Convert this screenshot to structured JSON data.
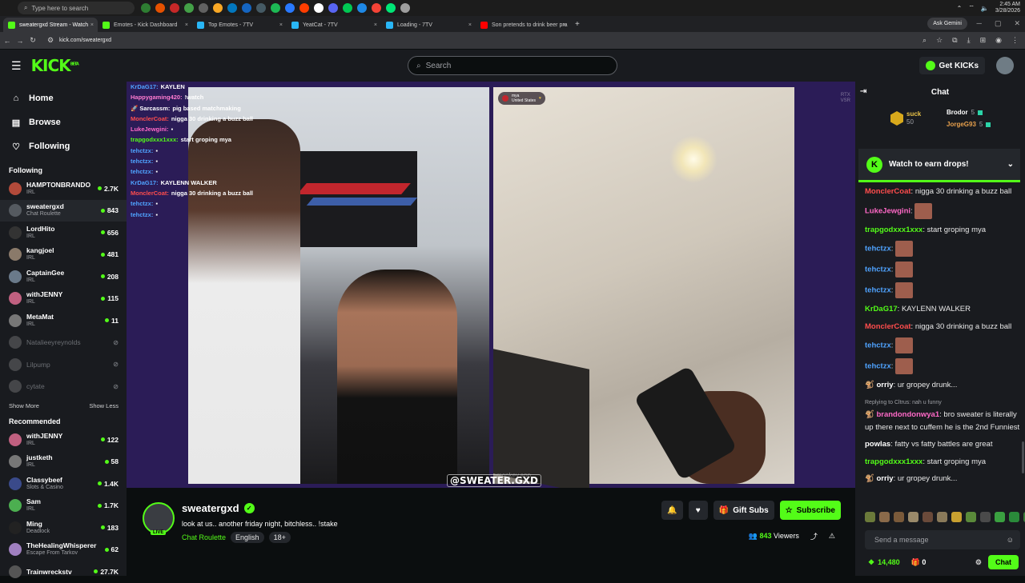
{
  "taskbar": {
    "search_placeholder": "Type here to search",
    "time": "2:45 AM",
    "date": "3/28/2026",
    "app_colors": [
      "#2e7d32",
      "#e65100",
      "#c62828",
      "#43a047",
      "#616161",
      "#f9a825",
      "#0277bd",
      "#1565c0",
      "#455a64",
      "#1db954",
      "#2979ff",
      "#ff3d00",
      "#ffffff",
      "#5865f2",
      "#00c853",
      "#1e88e5",
      "#f44336",
      "#00e676",
      "#9e9e9e"
    ]
  },
  "browser": {
    "tabs": [
      {
        "title": "sweatergxd Stream - Watch",
        "color": "#53fc18",
        "active": true
      },
      {
        "title": "Emotes - Kick Dashboard",
        "color": "#53fc18",
        "active": false
      },
      {
        "title": "Top Emotes - 7TV",
        "color": "#29b6f6",
        "active": false
      },
      {
        "title": "YeatCat - 7TV",
        "color": "#29b6f6",
        "active": false
      },
      {
        "title": "Loading - 7TV",
        "color": "#29b6f6",
        "active": false
      },
      {
        "title": "Son pretends to drink beer pra",
        "color": "#ff0000",
        "active": false
      }
    ],
    "ask_gemini": "Ask Gemini",
    "url": "kick.com/sweatergxd"
  },
  "kick_nav": {
    "logo": "KICK",
    "logo_sup": "BETA",
    "search_placeholder": "Search",
    "get_kicks": "Get KICKs"
  },
  "sidebar": {
    "main": [
      {
        "label": "Home",
        "icon": "home-icon",
        "glyph": "⌂"
      },
      {
        "label": "Browse",
        "icon": "browse-icon",
        "glyph": "▤"
      },
      {
        "label": "Following",
        "icon": "heart-icon",
        "glyph": "♡"
      }
    ],
    "following_title": "Following",
    "following": [
      {
        "name": "HAMPTONBRANDO",
        "category": "IRL",
        "viewers": "2.7K",
        "color": "#b24a3a",
        "offline": false,
        "selected": false
      },
      {
        "name": "sweatergxd",
        "category": "Chat Roulette",
        "viewers": "843",
        "color": "#555a60",
        "offline": false,
        "selected": true
      },
      {
        "name": "LordHito",
        "category": "IRL",
        "viewers": "656",
        "color": "#333",
        "offline": false,
        "selected": false
      },
      {
        "name": "kangjoel",
        "category": "IRL",
        "viewers": "481",
        "color": "#8a7a6a",
        "offline": false,
        "selected": false
      },
      {
        "name": "CaptainGee",
        "category": "IRL",
        "viewers": "208",
        "color": "#6a7a8a",
        "offline": false,
        "selected": false
      },
      {
        "name": "withJENNY",
        "category": "IRL",
        "viewers": "115",
        "color": "#c06080",
        "offline": false,
        "selected": false
      },
      {
        "name": "MetaMat",
        "category": "IRL",
        "viewers": "11",
        "color": "#777",
        "offline": false,
        "selected": false
      },
      {
        "name": "Natalieeyreynolds",
        "category": "",
        "viewers": "",
        "color": "#999",
        "offline": true,
        "selected": false
      },
      {
        "name": "Lilpump",
        "category": "",
        "viewers": "",
        "color": "#999",
        "offline": true,
        "selected": false
      },
      {
        "name": "cytate",
        "category": "",
        "viewers": "",
        "color": "#999",
        "offline": true,
        "selected": false
      }
    ],
    "show_more": "Show More",
    "show_less": "Show Less",
    "recommended_title": "Recommended",
    "recommended": [
      {
        "name": "withJENNY",
        "category": "IRL",
        "viewers": "122",
        "color": "#c06080"
      },
      {
        "name": "justketh",
        "category": "IRL",
        "viewers": "58",
        "color": "#777"
      },
      {
        "name": "Classybeef",
        "category": "Slots & Casino",
        "viewers": "1.4K",
        "color": "#3a4a8a"
      },
      {
        "name": "Sam",
        "category": "IRL",
        "viewers": "1.7K",
        "color": "#4caf50"
      },
      {
        "name": "Ming",
        "category": "Deadlock",
        "viewers": "183",
        "color": "#222"
      },
      {
        "name": "TheHealingWhisperer",
        "category": "Escape From Tarkov",
        "viewers": "62",
        "color": "#a080c0"
      },
      {
        "name": "Trainwreckstv",
        "category": "",
        "viewers": "27.7K",
        "color": "#555"
      }
    ]
  },
  "overlay_chat": [
    {
      "user": "KrDaG17:",
      "text": "KAYLEN",
      "color": "#4fa3ff"
    },
    {
      "user": "Happygaming420:",
      "text": "!watch",
      "color": "#ff7bd0"
    },
    {
      "user": "🚀 Sarcassm:",
      "text": "pig based matchmaking",
      "color": "#ffffff"
    },
    {
      "user": "MonclerCoat:",
      "text": "nigga 30 drinking a buzz ball",
      "color": "#ff4d4d"
    },
    {
      "user": "LukeJewgini:",
      "text": "▪",
      "color": "#ff69c7"
    },
    {
      "user": "trapgodxxx1xxx:",
      "text": "start groping mya",
      "color": "#53fc18"
    },
    {
      "user": "tehctzx:",
      "text": "▪",
      "color": "#4fa3ff"
    },
    {
      "user": "tehctzx:",
      "text": "▪",
      "color": "#4fa3ff"
    },
    {
      "user": "tehctzx:",
      "text": "▪",
      "color": "#4fa3ff"
    },
    {
      "user": "KrDaG17:",
      "text": "KAYLENN WALKER",
      "color": "#4fa3ff"
    },
    {
      "user": "MonclerCoat:",
      "text": "nigga 30 drinking a buzz ball",
      "color": "#ff4d4d"
    },
    {
      "user": "tehctzx:",
      "text": "▪",
      "color": "#4fa3ff"
    },
    {
      "user": "tehctzx:",
      "text": "▪",
      "color": "#4fa3ff"
    }
  ],
  "video": {
    "country_name": "mya",
    "country": "United States",
    "monkey": "monkey.app",
    "rtx_top": "RTX",
    "rtx_bottom": "VSR",
    "watermark": "@SWEATER.GXD"
  },
  "stream": {
    "name": "sweatergxd",
    "title": "look at us.. another friday night, bitchless.. !stake",
    "category": "Chat Roulette",
    "tags": [
      "English",
      "18+"
    ],
    "live": "LIVE",
    "viewers": "843",
    "viewers_label": "Viewers",
    "gift_subs": "Gift Subs",
    "subscribe": "Subscribe"
  },
  "chat": {
    "title": "Chat",
    "top_gift": {
      "name": "suck",
      "count": "50"
    },
    "gifters": [
      {
        "name": "Brodor",
        "count": "5",
        "color": "#ffffff"
      },
      {
        "name": "JorgeG93",
        "count": "5",
        "color": "#e7a04c"
      }
    ],
    "drops_label": "Watch to earn drops!",
    "messages": [
      {
        "user": "MonclerCoat",
        "text": "nigga 30 drinking a buzz ball",
        "color": "#ff4d4d",
        "emote": false,
        "reply": "",
        "badge": ""
      },
      {
        "user": "LukeJewgini",
        "text": "",
        "color": "#ff69c7",
        "emote": true,
        "reply": "",
        "badge": ""
      },
      {
        "user": "trapgodxxx1xxx",
        "text": "start groping mya",
        "color": "#53fc18",
        "emote": false,
        "reply": "",
        "badge": ""
      },
      {
        "user": "tehctzx",
        "text": "",
        "color": "#4fa3ff",
        "emote": true,
        "reply": "",
        "badge": ""
      },
      {
        "user": "tehctzx",
        "text": "",
        "color": "#4fa3ff",
        "emote": true,
        "reply": "",
        "badge": ""
      },
      {
        "user": "tehctzx",
        "text": "",
        "color": "#4fa3ff",
        "emote": true,
        "reply": "",
        "badge": ""
      },
      {
        "user": "KrDaG17",
        "text": "KAYLENN WALKER",
        "color": "#53fc18",
        "emote": false,
        "reply": "",
        "badge": ""
      },
      {
        "user": "MonclerCoat",
        "text": "nigga 30 drinking a buzz ball",
        "color": "#ff4d4d",
        "emote": false,
        "reply": "",
        "badge": ""
      },
      {
        "user": "tehctzx",
        "text": "",
        "color": "#4fa3ff",
        "emote": true,
        "reply": "",
        "badge": ""
      },
      {
        "user": "tehctzx",
        "text": "",
        "color": "#4fa3ff",
        "emote": true,
        "reply": "",
        "badge": ""
      },
      {
        "user": "orriy",
        "text": "ur gropey drunk...",
        "color": "#ffffff",
        "emote": false,
        "reply": "",
        "badge": "🐒"
      },
      {
        "user": "brandondonwya1",
        "text": "bro sweater is literally up there next to cuffem he is the 2nd Funniest",
        "color": "#ff69c7",
        "emote": false,
        "reply": "Replying to Cltrus: nah u funny",
        "badge": "🐒"
      },
      {
        "user": "powlas",
        "text": "fatty vs fatty battles are great",
        "color": "#ffffff",
        "emote": false,
        "reply": "",
        "badge": ""
      },
      {
        "user": "trapgodxxx1xxx",
        "text": "start groping mya",
        "color": "#53fc18",
        "emote": false,
        "reply": "",
        "badge": ""
      },
      {
        "user": "orriy",
        "text": "ur gropey drunk...",
        "color": "#ffffff",
        "emote": false,
        "reply": "",
        "badge": "🐒"
      }
    ],
    "send_placeholder": "Send a message",
    "kicks": "14,480",
    "gifts": "0",
    "chat_button": "Chat"
  }
}
